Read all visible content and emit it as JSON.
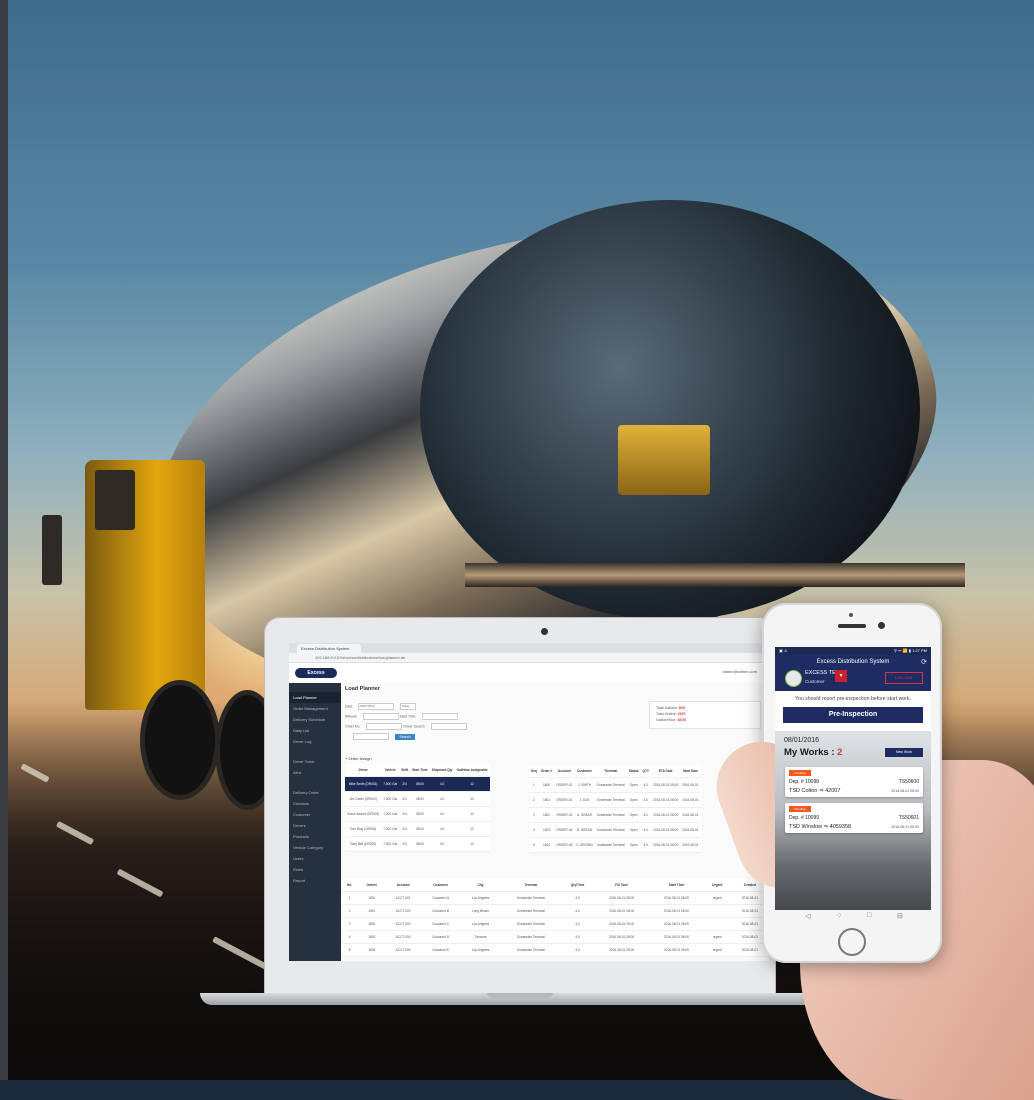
{
  "laptop": {
    "browser_tab": "Excess Distribution System",
    "url": "192.168.0.XXX/excess/distributions/loadplanner.do",
    "logo": "Excess",
    "user": "admin@admin.com",
    "sidebar": [
      "Load Planner",
      "Order Management",
      "Delivery Schedule",
      "Daily List",
      "Driver Log",
      "Driver Track",
      "Alert",
      "Delivery Order",
      "Contacts",
      "Customer",
      "Drivers",
      "Products",
      "Vehicle Category",
      "Users",
      "Roles",
      "Report"
    ],
    "page_title": "Load Planner",
    "form": {
      "date_label": "Date",
      "date_value": "2016-08-01",
      "today_btn": "Today",
      "wheels_label": "Wheels",
      "start_time_label": "Start Time",
      "order_no_label": "Order No.",
      "truck_no_label": "Driver Search",
      "search_label": "Search"
    },
    "totals": {
      "total_gallon_label": "Total Gallons:",
      "total_gallon": "500",
      "total_orders_label": "Total Orders:",
      "total_orders": "2007",
      "gallons_hr_label": "Gallon/Hour:",
      "gallons_hr": "15.00"
    },
    "order_assign_label": "+ Order Assign",
    "t1_headers": [
      "Driver",
      "Vehicle",
      "Shift",
      "Start Time",
      "Shipment Qty",
      "Gal/Hour Assignable"
    ],
    "t1_rows": [
      [
        "Mike Smith (DR001)",
        "7,500 Gal",
        "2/4",
        "08:00",
        "4.0",
        "12"
      ],
      [
        "Jim Carter (DR002)",
        "7,500 Gal",
        "2/4",
        "08:00",
        "4.0",
        "12"
      ],
      [
        "Grace Adams (DR003)",
        "7,500 Gal",
        "2/4",
        "08:00",
        "4.0",
        "12"
      ],
      [
        "Tom Bray (DR004)",
        "7,500 Gal",
        "2/4",
        "08:00",
        "4.0",
        "12"
      ],
      [
        "Gary Bell (DR005)",
        "7,500 Gal",
        "2/4",
        "08:00",
        "4.0",
        "12"
      ]
    ],
    "t2_headers": [
      "Seq",
      "Order #",
      "Account",
      "Customer",
      "Terminal",
      "Status",
      "QTY",
      "ETA Date",
      "Start Date"
    ],
    "t2_rows": [
      [
        "1",
        "1800",
        "ORDER-01",
        "J. SMITH",
        "Oceanside Terminal",
        "Open",
        "4.0",
        "2016-08-01 08:00",
        "2016-08-01"
      ],
      [
        "2",
        "1801",
        "ORDER-02",
        "J. DOE",
        "Oceanside Terminal",
        "Open",
        "4.0",
        "2016-08-01 08:00",
        "2016-08-01"
      ],
      [
        "3",
        "1802",
        "ORDER-03",
        "A. GRACE",
        "Oceanside Terminal",
        "Open",
        "4.0",
        "2016-08-01 08:00",
        "2016-08-01"
      ],
      [
        "4",
        "1803",
        "ORDER-04",
        "B. GREEN",
        "Oceanside Terminal",
        "Open",
        "4.0",
        "2016-08-01 08:00",
        "2016-08-01"
      ],
      [
        "5",
        "1804",
        "ORDER-05",
        "C. BROWN",
        "Oceanside Terminal",
        "Open",
        "4.0",
        "2016-08-01 08:00",
        "2016-08-01"
      ]
    ],
    "t3_headers": [
      "No.",
      "Order#",
      "Account",
      "Customer",
      "City",
      "Terminal",
      "Qty/Time",
      "Fill Time",
      "Start Time",
      "Urgent",
      "Created"
    ],
    "t3_rows": [
      [
        "1",
        "1800",
        "ACCT-001",
        "Customer A",
        "Los Angeles",
        "Oceanside Terminal",
        "4.0",
        "2016-08-01 08:00",
        "2016-08-01 08:00",
        "urgent",
        "2016-08-01"
      ],
      [
        "2",
        "1801",
        "ACCT-002",
        "Customer B",
        "Long Beach",
        "Oceanside Terminal",
        "4.0",
        "2016-08-01 08:00",
        "2016-08-01 08:00",
        "",
        "2016-08-01"
      ],
      [
        "3",
        "1802",
        "ACCT-003",
        "Customer C",
        "Los Angeles",
        "Oceanside Terminal",
        "4.0",
        "2016-08-01 08:00",
        "2016-08-01 08:00",
        "",
        "2016-08-01"
      ],
      [
        "4",
        "1803",
        "ACCT-004",
        "Customer D",
        "Torrance",
        "Oceanside Terminal",
        "4.0",
        "2016-08-01 08:00",
        "2016-08-01 08:00",
        "urgent",
        "2016-08-01"
      ],
      [
        "5",
        "1804",
        "ACCT-005",
        "Customer E",
        "Los Angeles",
        "Oceanside Terminal",
        "4.0",
        "2016-08-01 08:00",
        "2016-08-01 08:00",
        "urgent",
        "2016-08-01"
      ]
    ]
  },
  "phone": {
    "status_left": "▣ ⚠",
    "status_right": "⚲ ᯤ 📶 ▮ 1:27 PM",
    "app_title": "Excess Distribution System",
    "user_name": "EXCESS TEST",
    "user_sub": "Customer",
    "logout": "LOG OUT",
    "notice": "You should report pre-inspection before start work.",
    "pre_inspection": "Pre-Inspection",
    "date": "08/01/2016",
    "my_works_label": "My Works :",
    "my_works_count": "2",
    "new_work_btn": "New Work",
    "cards": [
      {
        "tag": "Pending",
        "line1": "Dep. # 10098",
        "line2": "TSD Colton ⇒ 42007",
        "right1": "TS50600",
        "right2": "2016-08-01 08:00"
      },
      {
        "tag": "Pending",
        "line1": "Dep. # 10099",
        "line2": "TSD Winslow ⇒ 4059358",
        "right1": "TS50601",
        "right2": "2016-08-01 08:00"
      }
    ],
    "nav": [
      "◁",
      "○",
      "□",
      "⊟"
    ]
  },
  "colors": {
    "navy": "#1f2c63",
    "red": "#d9342b",
    "orange": "#f05a1f",
    "sidebar": "#263140"
  }
}
